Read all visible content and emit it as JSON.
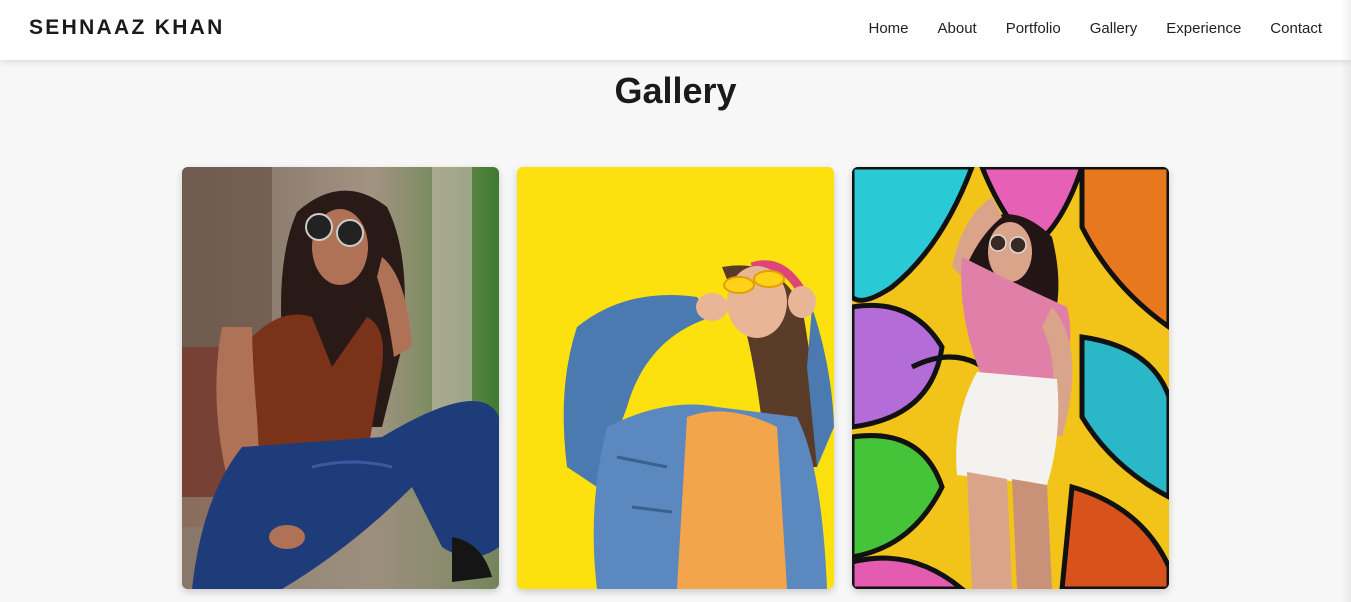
{
  "brand": {
    "name": "SEHNAAZ KHAN"
  },
  "nav": {
    "items": [
      {
        "label": "Home"
      },
      {
        "label": "About"
      },
      {
        "label": "Portfolio"
      },
      {
        "label": "Gallery"
      },
      {
        "label": "Experience"
      },
      {
        "label": "Contact"
      }
    ]
  },
  "gallery": {
    "title": "Gallery",
    "photos": [
      {
        "subject": "woman-in-sunglasses-rust-top-jeans-seated",
        "background": "urban-building-wall",
        "accent": "#8a3a1a"
      },
      {
        "subject": "woman-in-denim-jacket-laughing",
        "background": "yellow-wall",
        "accent": "#fce315"
      },
      {
        "subject": "woman-in-pink-top-white-skirt",
        "background": "colorful-graffiti-wall",
        "accent": "#e86fb5"
      }
    ]
  }
}
